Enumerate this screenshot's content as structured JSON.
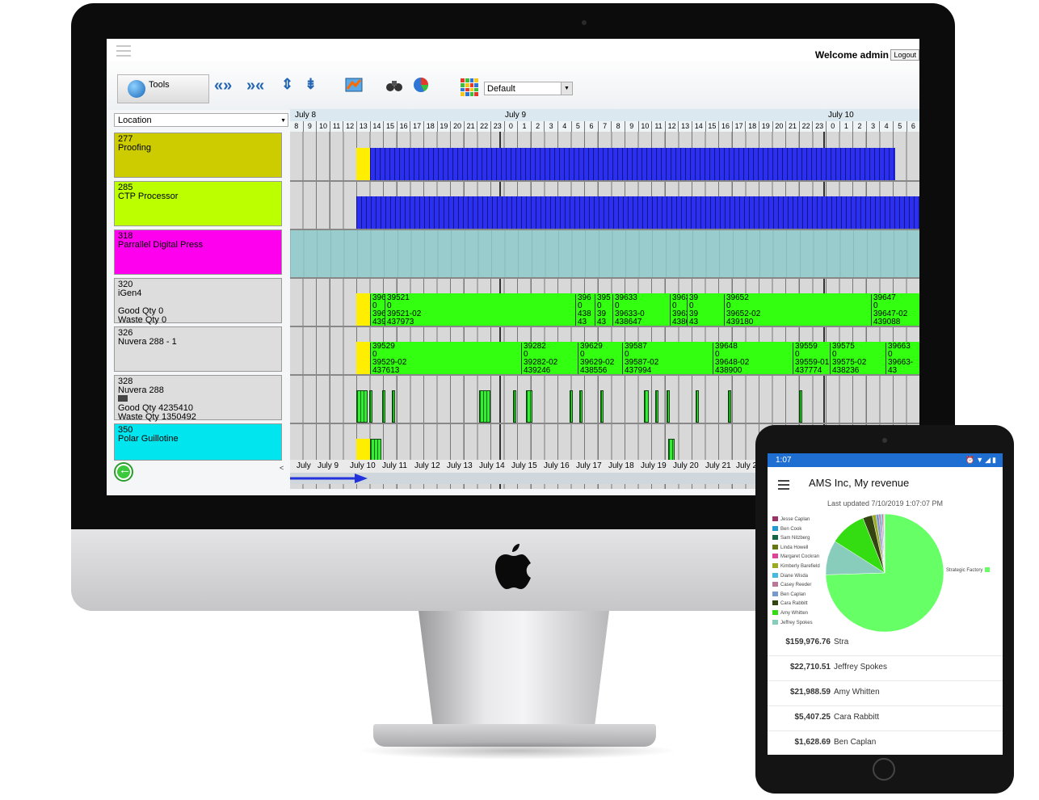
{
  "header": {
    "welcome": "Welcome admin",
    "logout": "Logout"
  },
  "toolbar": {
    "tools_label": "Tools",
    "view_select": "Default"
  },
  "location_select": "Location",
  "resources": [
    {
      "id": "277",
      "name": "Proofing",
      "color": "#cccc00",
      "lines": []
    },
    {
      "id": "285",
      "name": "CTP Processor",
      "color": "#bbff00",
      "lines": []
    },
    {
      "id": "318",
      "name": "Parrallel Digital Press",
      "color": "#ff00ee",
      "lines": []
    },
    {
      "id": "320",
      "name": "iGen4",
      "color": "#dddddd",
      "lines": [
        "Good Qty 0",
        "Waste Qty 0"
      ]
    },
    {
      "id": "326",
      "name": "Nuvera 288 - 1",
      "color": "#dddddd",
      "lines": []
    },
    {
      "id": "328",
      "name": "Nuvera 288",
      "color": "#dddddd",
      "lines": [
        "Good Qty 4235410",
        "Waste Qty 1350492"
      ]
    },
    {
      "id": "350",
      "name": "Polar Guillotine",
      "color": "#00e5ee",
      "lines": []
    }
  ],
  "gantt": {
    "days": [
      "July 8",
      "July 9",
      "July 10"
    ],
    "hours": [
      "8",
      "9",
      "10",
      "11",
      "12",
      "13",
      "14",
      "15",
      "16",
      "17",
      "18",
      "19",
      "20",
      "21",
      "22",
      "23",
      "0",
      "1",
      "2",
      "3",
      "4",
      "5",
      "6",
      "7",
      "8",
      "9",
      "10",
      "11",
      "12",
      "13",
      "14",
      "15",
      "16",
      "17",
      "18",
      "19",
      "20",
      "21",
      "22",
      "23",
      "0",
      "1",
      "2",
      "3",
      "4",
      "5",
      "6"
    ],
    "iGen4_jobs": [
      {
        "lines": [
          "396",
          "0",
          "396",
          "439"
        ]
      },
      {
        "lines": [
          "39521",
          "0",
          "39521-02",
          "437973"
        ]
      },
      {
        "lines": [
          "396",
          "0",
          "438",
          "43"
        ]
      },
      {
        "lines": [
          "395",
          "0",
          "39",
          "43"
        ]
      },
      {
        "lines": [
          "39633",
          "0",
          "39633-0",
          "438647"
        ]
      },
      {
        "lines": [
          "3963",
          "0",
          "3963",
          "4386"
        ]
      },
      {
        "lines": [
          "39",
          "0",
          "39",
          "43"
        ]
      },
      {
        "lines": [
          "39652",
          "0",
          "39652-02",
          "439180"
        ]
      },
      {
        "lines": [
          "39647",
          "0",
          "39647-02",
          "439088"
        ]
      }
    ],
    "nuvera_jobs": [
      {
        "lines": [
          "39529",
          "0",
          "39529-02",
          "437613"
        ]
      },
      {
        "lines": [
          "39282",
          "0",
          "39282-02",
          "439246"
        ]
      },
      {
        "lines": [
          "39629",
          "0",
          "39629-02",
          "438556"
        ]
      },
      {
        "lines": [
          "39587",
          "0",
          "39587-02",
          "437994"
        ]
      },
      {
        "lines": [
          "39648",
          "0",
          "39648-02",
          "438900"
        ]
      },
      {
        "lines": [
          "39559",
          "0",
          "39559-01",
          "437774"
        ]
      },
      {
        "lines": [
          "39575",
          "0",
          "39575-02",
          "438236"
        ]
      },
      {
        "lines": [
          "39663",
          "0",
          "39663-",
          "43"
        ]
      }
    ],
    "red_job": {
      "lines": [
        "395",
        "0",
        "395",
        "43"
      ]
    },
    "date_ticks": [
      "July",
      "July 9",
      "July 10",
      "July 11",
      "July 12",
      "July 13",
      "July 14",
      "July 15",
      "July 16",
      "July 17",
      "July 18",
      "July 19",
      "July 20",
      "July 21",
      "July 2"
    ]
  },
  "tablet": {
    "time": "1:07",
    "title": "AMS Inc, My revenue",
    "updated": "Last updated 7/10/2019 1:07:07 PM",
    "legend": [
      {
        "name": "Jesse Caplan",
        "color": "#993366"
      },
      {
        "name": "Ben Cook",
        "color": "#1f9bd1"
      },
      {
        "name": "Sam Nitzberg",
        "color": "#116644"
      },
      {
        "name": "Linda Howell",
        "color": "#667711"
      },
      {
        "name": "Margaret Cockran",
        "color": "#dd4499"
      },
      {
        "name": "Kimberly Barefield",
        "color": "#99aa22"
      },
      {
        "name": "Diane Wisda",
        "color": "#44bbdd"
      },
      {
        "name": "Casey Reeder",
        "color": "#bb7799"
      },
      {
        "name": "Ben Caplan",
        "color": "#7799cc"
      },
      {
        "name": "Cara Rabbitt",
        "color": "#334411"
      },
      {
        "name": "Amy Whitten",
        "color": "#33dd11"
      },
      {
        "name": "Jeffrey Spokes",
        "color": "#88ccbb"
      }
    ],
    "pie_label": "Strategic Factory",
    "rows": [
      {
        "amount": "$159,976.76",
        "name": "Stra"
      },
      {
        "amount": "$22,710.51",
        "name": "Jeffrey Spokes"
      },
      {
        "amount": "$21,988.59",
        "name": "Amy Whitten"
      },
      {
        "amount": "$5,407.25",
        "name": "Cara Rabbitt"
      },
      {
        "amount": "$1,628.69",
        "name": "Ben Caplan"
      }
    ]
  }
}
